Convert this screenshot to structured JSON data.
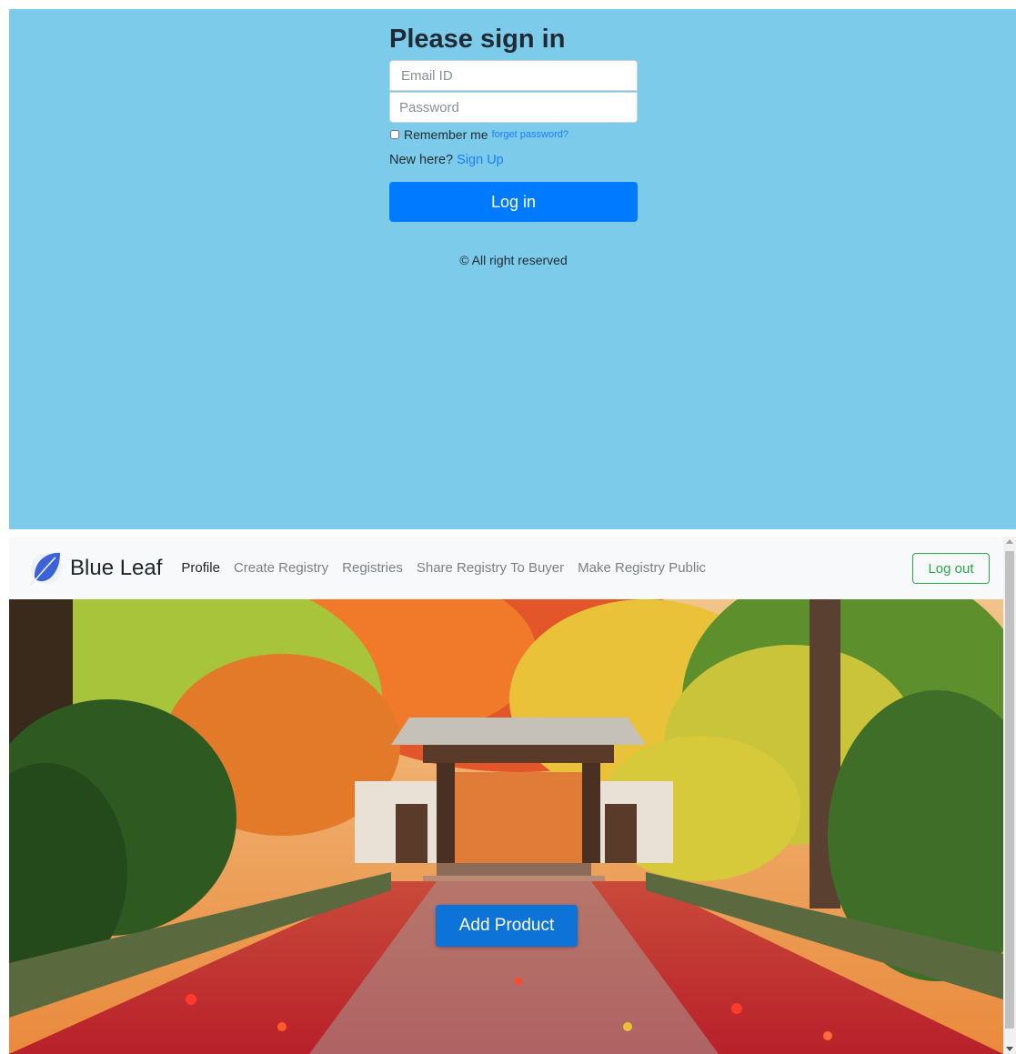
{
  "login": {
    "title": "Please sign in",
    "email_placeholder": "Email ID",
    "password_placeholder": "Password",
    "remember_label": "Remember me",
    "remember_checked": false,
    "forgot_link": "forget password?",
    "new_here_text": "New here?",
    "signup_link": "Sign Up",
    "login_button": "Log in",
    "copyright": "© All right reserved",
    "background_color": "#7ccbea",
    "button_color": "#007bff"
  },
  "app": {
    "brand": {
      "name": "Blue Leaf",
      "logo_icon": "blue-leaf-logo-icon"
    },
    "nav": {
      "items": [
        {
          "label": "Profile",
          "active": true
        },
        {
          "label": "Create Registry",
          "active": false
        },
        {
          "label": "Registries",
          "active": false
        },
        {
          "label": "Share Registry To Buyer",
          "active": false
        },
        {
          "label": "Make Registry Public",
          "active": false
        }
      ]
    },
    "logout_button": "Log out",
    "hero": {
      "image_subject": "autumn garden path with red maple leaves leading to a temple gate",
      "add_product_button": "Add Product"
    },
    "accent_color": "#28a745"
  }
}
